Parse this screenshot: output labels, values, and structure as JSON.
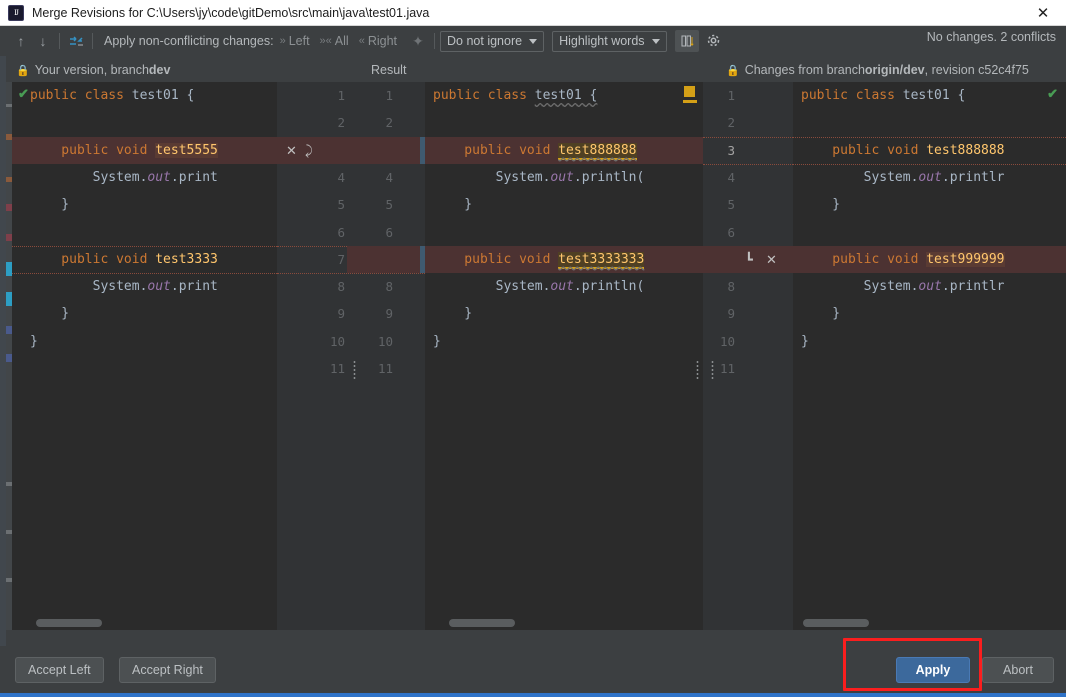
{
  "window": {
    "title": "Merge Revisions for C:\\Users\\jy\\code\\gitDemo\\src\\main\\java\\test01.java",
    "close_label": "✕",
    "app_icon": "intellij-idea-icon"
  },
  "toolbar": {
    "prev_icon": "arrow-up-icon",
    "next_icon": "arrow-down-icon",
    "magic_resolve_icon": "apply-non-conflicting-icon",
    "apply_label": "Apply non-conflicting changes:",
    "actions": [
      {
        "name": "left",
        "label": "Left",
        "icon": "chevron-right-double-icon"
      },
      {
        "name": "all",
        "label": "All",
        "icon": "chevron-both-icon"
      },
      {
        "name": "right",
        "label": "Right",
        "icon": "chevron-left-double-icon"
      }
    ],
    "wand_icon": "magic-wand-icon",
    "ignore_combo": {
      "value": "Do not ignore",
      "icon": "chevron-down-icon"
    },
    "highlight_combo": {
      "value": "Highlight words",
      "icon": "chevron-down-icon"
    },
    "collapse_icon": "collapse-unchanged-icon",
    "settings_icon": "gear-icon",
    "status": "No changes. 2 conflicts"
  },
  "headers": {
    "left": {
      "prefix": "Your version, branch ",
      "branch": "dev",
      "lock_icon": "lock-icon"
    },
    "center": {
      "label": "Result"
    },
    "right": {
      "prefix": "Changes from branch ",
      "branch": "origin/dev",
      "suffix": ", revision c52c4f75",
      "lock_icon": "lock-icon"
    }
  },
  "panes": {
    "left": {
      "name": "left-version-pane",
      "status_icon": "green-check-icon",
      "lines": [
        {
          "n": 1,
          "segments": [
            {
              "t": "public class ",
              "c": "kw-class"
            },
            {
              "t": "test01 {",
              "c": "cls"
            }
          ]
        },
        {
          "n": 2,
          "segments": []
        },
        {
          "n": 3,
          "segments": [
            {
              "t": "    public void ",
              "c": "kw"
            },
            {
              "t": "test5555",
              "c": "id-hl"
            }
          ],
          "conflict": true
        },
        {
          "n": 4,
          "segments": [
            {
              "t": "        System.",
              "c": "pl"
            },
            {
              "t": "out",
              "c": "fld"
            },
            {
              "t": ".print",
              "c": "pl"
            }
          ]
        },
        {
          "n": 5,
          "segments": [
            {
              "t": "    }",
              "c": "pl"
            }
          ]
        },
        {
          "n": 6,
          "segments": []
        },
        {
          "n": 7,
          "segments": [
            {
              "t": "    public void ",
              "c": "kw"
            },
            {
              "t": "test3333",
              "c": "id"
            }
          ],
          "changed": true
        },
        {
          "n": 8,
          "segments": [
            {
              "t": "        System.",
              "c": "pl"
            },
            {
              "t": "out",
              "c": "fld"
            },
            {
              "t": ".print",
              "c": "pl"
            }
          ]
        },
        {
          "n": 9,
          "segments": [
            {
              "t": "    }",
              "c": "pl"
            }
          ]
        },
        {
          "n": 10,
          "segments": [
            {
              "t": "}",
              "c": "pl"
            }
          ]
        },
        {
          "n": 11,
          "segments": []
        }
      ]
    },
    "center": {
      "name": "result-pane",
      "marker_icon": "gold-marker-icon",
      "lines": [
        {
          "n": 1,
          "segments": [
            {
              "t": "public class ",
              "c": "kw-class"
            },
            {
              "t": "test01 {",
              "c": "cls-wavy"
            }
          ]
        },
        {
          "n": 2,
          "segments": []
        },
        {
          "n": 3,
          "segments": [
            {
              "t": "    public void ",
              "c": "kw"
            },
            {
              "t": "test888888",
              "c": "id-wavy-hl"
            }
          ],
          "conflict": true
        },
        {
          "n": 4,
          "segments": [
            {
              "t": "        System.",
              "c": "pl"
            },
            {
              "t": "out",
              "c": "fld"
            },
            {
              "t": ".println(",
              "c": "pl"
            }
          ]
        },
        {
          "n": 5,
          "segments": [
            {
              "t": "    }",
              "c": "pl"
            }
          ]
        },
        {
          "n": 6,
          "segments": []
        },
        {
          "n": 7,
          "segments": [
            {
              "t": "    public void ",
              "c": "kw"
            },
            {
              "t": "test3333333",
              "c": "id-wavy-hl"
            }
          ],
          "conflict": true
        },
        {
          "n": 8,
          "segments": [
            {
              "t": "        System.",
              "c": "pl"
            },
            {
              "t": "out",
              "c": "fld"
            },
            {
              "t": ".println(",
              "c": "pl"
            }
          ]
        },
        {
          "n": 9,
          "segments": [
            {
              "t": "    }",
              "c": "pl"
            }
          ]
        },
        {
          "n": 10,
          "segments": [
            {
              "t": "}",
              "c": "pl"
            }
          ]
        },
        {
          "n": 11,
          "segments": []
        }
      ]
    },
    "right": {
      "name": "right-version-pane",
      "status_icon": "green-check-icon",
      "lines": [
        {
          "n": 1,
          "segments": [
            {
              "t": "public class ",
              "c": "kw-class"
            },
            {
              "t": "test01 {",
              "c": "cls"
            }
          ]
        },
        {
          "n": 2,
          "segments": []
        },
        {
          "n": 3,
          "segments": [
            {
              "t": "    public void ",
              "c": "kw"
            },
            {
              "t": "test888888",
              "c": "id"
            }
          ],
          "changed": true
        },
        {
          "n": 4,
          "segments": [
            {
              "t": "        System.",
              "c": "pl"
            },
            {
              "t": "out",
              "c": "fld"
            },
            {
              "t": ".printlr",
              "c": "pl"
            }
          ]
        },
        {
          "n": 5,
          "segments": [
            {
              "t": "    }",
              "c": "pl"
            }
          ]
        },
        {
          "n": 6,
          "segments": []
        },
        {
          "n": 7,
          "segments": [
            {
              "t": "    public void ",
              "c": "kw"
            },
            {
              "t": "test999999",
              "c": "id-hl"
            }
          ],
          "conflict": true
        },
        {
          "n": 8,
          "segments": [
            {
              "t": "        System.",
              "c": "pl"
            },
            {
              "t": "out",
              "c": "fld"
            },
            {
              "t": ".printlr",
              "c": "pl"
            }
          ]
        },
        {
          "n": 9,
          "segments": [
            {
              "t": "    }",
              "c": "pl"
            }
          ]
        },
        {
          "n": 10,
          "segments": [
            {
              "t": "}",
              "c": "pl"
            }
          ]
        },
        {
          "n": 11,
          "segments": []
        }
      ]
    }
  },
  "gutter_actions": {
    "left_conflict": {
      "remove_icon": "✕",
      "accept_icon": "⤸"
    },
    "right_conflict": {
      "accept_icon": "┗",
      "remove_icon": "✕"
    }
  },
  "footer": {
    "accept_left": "Accept Left",
    "accept_right": "Accept Right",
    "apply": "Apply",
    "abort": "Abort",
    "highlight_color": "#fb1e1e",
    "primary_color": "#3c699c"
  }
}
